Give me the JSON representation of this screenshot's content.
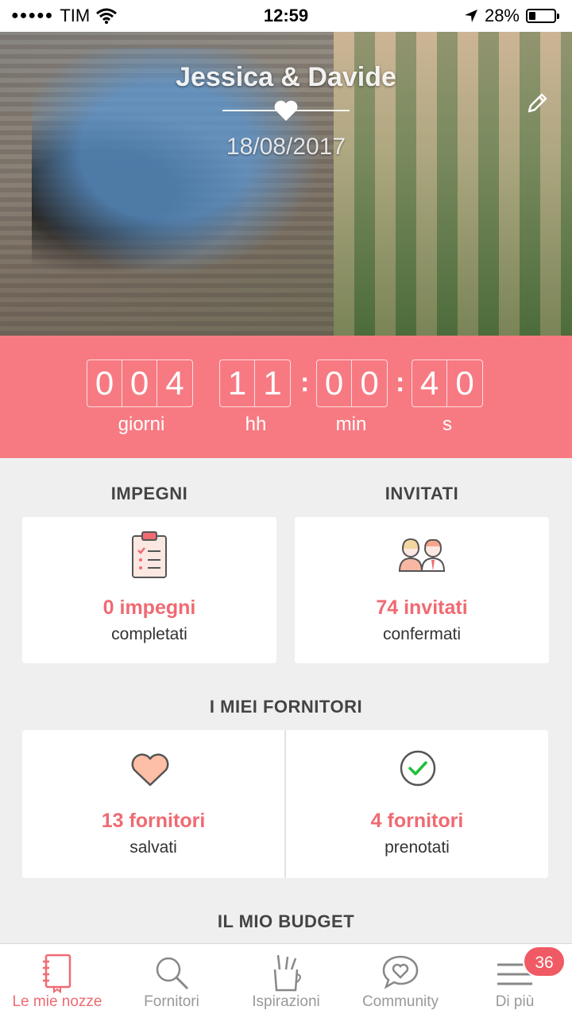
{
  "status_bar": {
    "carrier": "TIM",
    "time": "12:59",
    "battery": "28%",
    "battery_level": 0.28
  },
  "hero": {
    "couple_name": "Jessica & Davide",
    "wedding_date": "18/08/2017"
  },
  "countdown": {
    "days": [
      "0",
      "0",
      "4"
    ],
    "hours": [
      "1",
      "1"
    ],
    "minutes": [
      "0",
      "0"
    ],
    "seconds": [
      "4",
      "0"
    ],
    "labels": {
      "days": "giorni",
      "hours": "hh",
      "minutes": "min",
      "seconds": "s"
    }
  },
  "impegni": {
    "title": "IMPEGNI",
    "count": "0 impegni",
    "sub": "completati"
  },
  "invitati": {
    "title": "INVITATI",
    "count": "74 invitati",
    "sub": "confermati"
  },
  "fornitori": {
    "title": "I MIEI FORNITORI",
    "saved": {
      "count": "13 fornitori",
      "sub": "salvati"
    },
    "booked": {
      "count": "4 fornitori",
      "sub": "prenotati"
    }
  },
  "budget": {
    "title": "IL MIO BUDGET"
  },
  "tabs": [
    {
      "label": "Le mie nozze",
      "icon": "notebook-icon"
    },
    {
      "label": "Fornitori",
      "icon": "search-icon"
    },
    {
      "label": "Ispirazioni",
      "icon": "pencil-cup-icon"
    },
    {
      "label": "Community",
      "icon": "chat-heart-icon"
    },
    {
      "label": "Di più",
      "icon": "menu-icon",
      "badge": "36"
    }
  ],
  "colors": {
    "accent": "#f77a82",
    "accent_text": "#f06a72",
    "badge": "#f05a64"
  }
}
